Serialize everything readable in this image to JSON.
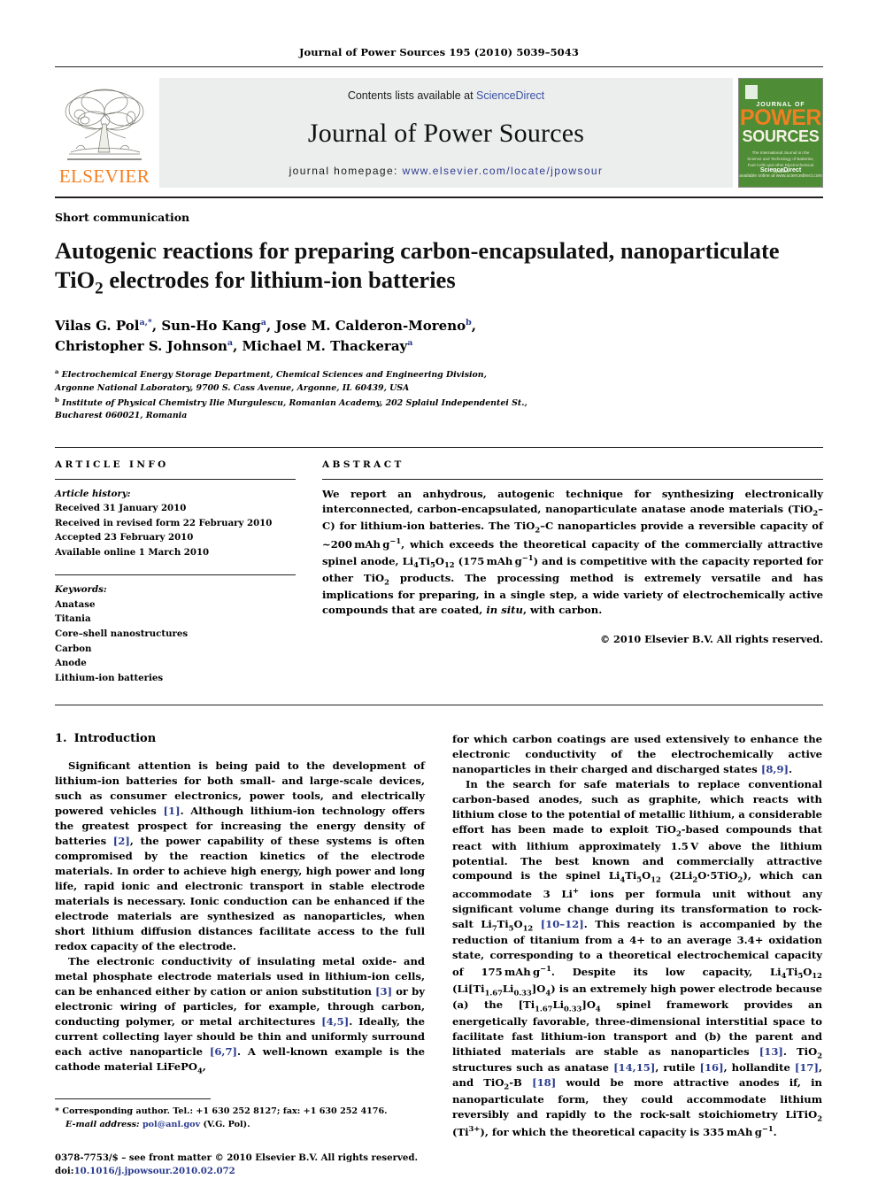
{
  "running_head": "Journal of Power Sources 195 (2010) 5039–5043",
  "masthead": {
    "contents_prefix": "Contents lists available at ",
    "sciencedirect": "ScienceDirect",
    "journal_title": "Journal of Power Sources",
    "homepage_prefix": "journal homepage:",
    "homepage_url": "www.elsevier.com/locate/jpowsour",
    "publisher_logo_word": "ELSEVIER",
    "accent_orange": "#f57f20",
    "link_blue": "#3a53a4",
    "cover": {
      "journal_of": "JOURNAL OF",
      "power": "POWER",
      "sources": "SOURCES",
      "subtitle": "The International Journal on the Science and Technology of Batteries, Fuel Cells and other Electrochemical Systems",
      "sciencedirect_label": "ScienceDirect",
      "available_online": "available online at www.sciencedirect.com",
      "background": "#4e8c35"
    }
  },
  "article": {
    "category": "Short communication",
    "title_part1": "Autogenic reactions for preparing carbon-encapsulated, nanoparticulate TiO",
    "title_sub": "2",
    "title_part2": " electrodes for lithium-ion batteries",
    "authors_line1": "Vilas G. Pol",
    "authors": "Vilas G. Pol a,*, Sun-Ho Kang a, Jose M. Calderon-Moreno b, Christopher S. Johnson a, Michael M. Thackeray a",
    "affiliation_a_line1": "Electrochemical Energy Storage Department, Chemical Sciences and Engineering Division,",
    "affiliation_a_line2": "Argonne National Laboratory, 9700 S. Cass Avenue, Argonne, IL 60439, USA",
    "affiliation_b_line1": "Institute of Physical Chemistry Ilie Murgulescu, Romanian Academy, 202 Splaiul Independentei St.,",
    "affiliation_b_line2": "Bucharest 060021, Romania"
  },
  "article_info": {
    "heading": "ARTICLE INFO",
    "history_label": "Article history:",
    "history": [
      "Received 31 January 2010",
      "Received in revised form 22 February 2010",
      "Accepted 23 February 2010",
      "Available online 1 March 2010"
    ],
    "keywords_label": "Keywords:",
    "keywords": [
      "Anatase",
      "Titania",
      "Core–shell nanostructures",
      "Carbon",
      "Anode",
      "Lithium-ion batteries"
    ]
  },
  "abstract": {
    "heading": "ABSTRACT",
    "copyright": "© 2010 Elsevier B.V. All rights reserved."
  },
  "body": {
    "section1_num": "1.",
    "section1_title": "Introduction",
    "footnote_marker": "*",
    "footnote_corresponding": "Corresponding author. Tel.: +1 630 252 8127; fax: +1 630 252 4176.",
    "footnote_email_label": "E-mail address:",
    "footnote_email": "pol@anl.gov",
    "footnote_email_owner": "(V.G. Pol).",
    "imprint_line1": "0378-7753/$ – see front matter © 2010 Elsevier B.V. All rights reserved.",
    "imprint_doi_label": "doi:",
    "imprint_doi": "10.1016/j.jpowsour.2010.02.072"
  }
}
